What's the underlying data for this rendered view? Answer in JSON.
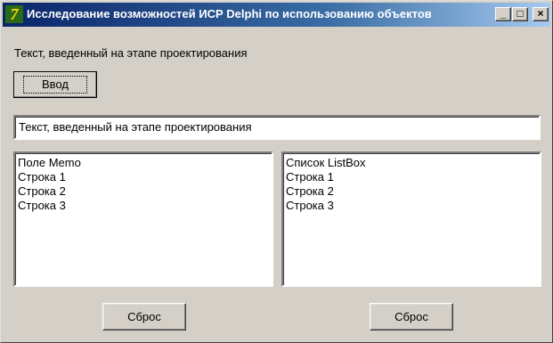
{
  "window": {
    "title": "Исследование возможностей ИСР Delphi по использованию объектов",
    "icon": "delphi-app-icon",
    "controls": {
      "minimize": "_",
      "maximize": "□",
      "close": "×"
    }
  },
  "label": {
    "text": "Текст, введенный на этапе проектирования"
  },
  "enter_button": {
    "label": "Ввод"
  },
  "edit": {
    "value": "Текст, введенный на этапе проектирования"
  },
  "memo": {
    "lines": [
      "Поле Memo",
      "Строка 1",
      "Строка 2",
      "Строка 3"
    ]
  },
  "listbox": {
    "items": [
      "Список ListBox",
      "Строка 1",
      "Строка 2",
      "Строка 3"
    ]
  },
  "reset_buttons": [
    {
      "label": "Сброс"
    },
    {
      "label": "Сброс"
    }
  ],
  "colors": {
    "face": "#d4d0c8",
    "titlebar_start": "#0a246a",
    "titlebar_end": "#a6caf0"
  }
}
